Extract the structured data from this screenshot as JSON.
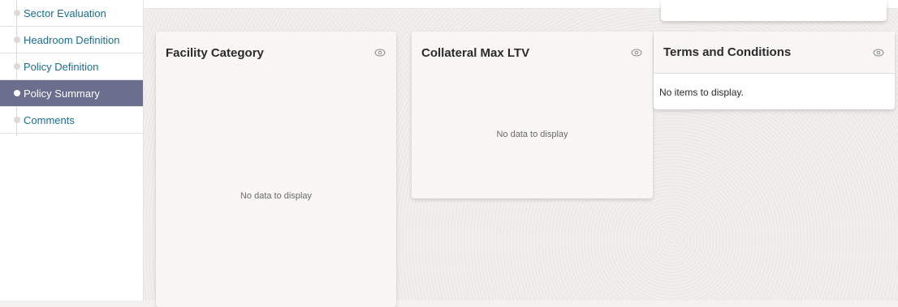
{
  "sidebar": {
    "items": [
      {
        "label": "Sector Evaluation",
        "active": false
      },
      {
        "label": "Headroom Definition",
        "active": false
      },
      {
        "label": "Policy Definition",
        "active": false
      },
      {
        "label": "Policy Summary",
        "active": true
      },
      {
        "label": "Comments",
        "active": false
      }
    ]
  },
  "cards": {
    "facility": {
      "title": "Facility Category",
      "empty": "No data to display",
      "icon": "eye-icon"
    },
    "collateral": {
      "title": "Collateral Max LTV",
      "empty": "No data to display",
      "icon": "eye-icon"
    },
    "terms": {
      "title": "Terms and Conditions",
      "empty": "No items to display.",
      "icon": "eye-icon"
    }
  },
  "colors": {
    "active_bg": "#6b6f8d",
    "link": "#1a6d8e"
  }
}
